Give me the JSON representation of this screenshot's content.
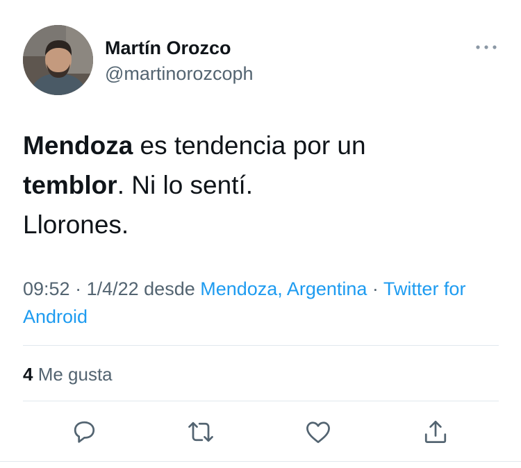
{
  "author": {
    "name": "Martín Orozco",
    "handle": "@martinorozcoph"
  },
  "tweet": {
    "line1_bold": "Mendoza",
    "line1_rest": " es tendencia por un",
    "line2_bold": "temblor",
    "line2_rest": ". Ni lo sentí.",
    "line3": "Llorones."
  },
  "meta": {
    "time": "09:52",
    "sep1": " · ",
    "date": "1/4/22",
    "from": " desde ",
    "location": "Mendoza, Argentina",
    "sep2": " · ",
    "source": "Twitter for Android"
  },
  "stats": {
    "likes_count": "4",
    "likes_label": " Me gusta"
  },
  "icons": {
    "more": "more-horizontal-icon",
    "reply": "reply-icon",
    "retweet": "retweet-icon",
    "like": "heart-icon",
    "share": "share-icon"
  },
  "colors": {
    "link": "#1d9bf0",
    "secondary": "#536471",
    "primary_text": "#0f1419",
    "divider": "#e1e8ed"
  }
}
